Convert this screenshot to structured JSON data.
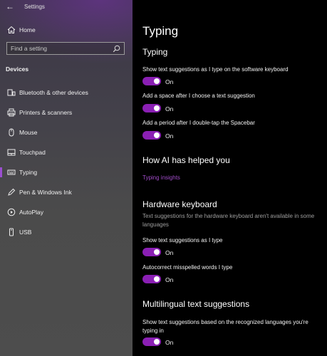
{
  "window": {
    "title": "Settings"
  },
  "sidebar": {
    "home_label": "Home",
    "search_placeholder": "Find a setting",
    "section": "Devices",
    "items": [
      {
        "label": "Bluetooth & other devices",
        "icon": "bluetooth-devices-icon"
      },
      {
        "label": "Printers & scanners",
        "icon": "printer-icon"
      },
      {
        "label": "Mouse",
        "icon": "mouse-icon"
      },
      {
        "label": "Touchpad",
        "icon": "touchpad-icon"
      },
      {
        "label": "Typing",
        "icon": "keyboard-icon",
        "selected": true
      },
      {
        "label": "Pen & Windows Ink",
        "icon": "pen-icon"
      },
      {
        "label": "AutoPlay",
        "icon": "autoplay-icon"
      },
      {
        "label": "USB",
        "icon": "usb-icon"
      }
    ]
  },
  "main": {
    "title": "Typing",
    "typing_section": {
      "heading": "Typing",
      "settings": [
        {
          "label": "Show text suggestions as I type on the software keyboard",
          "state": "On"
        },
        {
          "label": "Add a space after I choose a text suggestion",
          "state": "On"
        },
        {
          "label": "Add a period after I double-tap the Spacebar",
          "state": "On"
        }
      ]
    },
    "ai_section": {
      "heading": "How AI has helped you",
      "link": "Typing insights"
    },
    "hardware_section": {
      "heading": "Hardware keyboard",
      "description": "Text suggestions for the hardware keyboard aren't available in some languages",
      "settings": [
        {
          "label": "Show text suggestions as I type",
          "state": "On"
        },
        {
          "label": "Autocorrect misspelled words I type",
          "state": "On"
        }
      ]
    },
    "multilingual_section": {
      "heading": "Multilingual text suggestions",
      "description": "Show text suggestions based on the recognized languages you're typing in",
      "state": "On"
    }
  },
  "colors": {
    "accent": "#8a1fb4",
    "link": "#a14cc9",
    "background": "#000000"
  }
}
